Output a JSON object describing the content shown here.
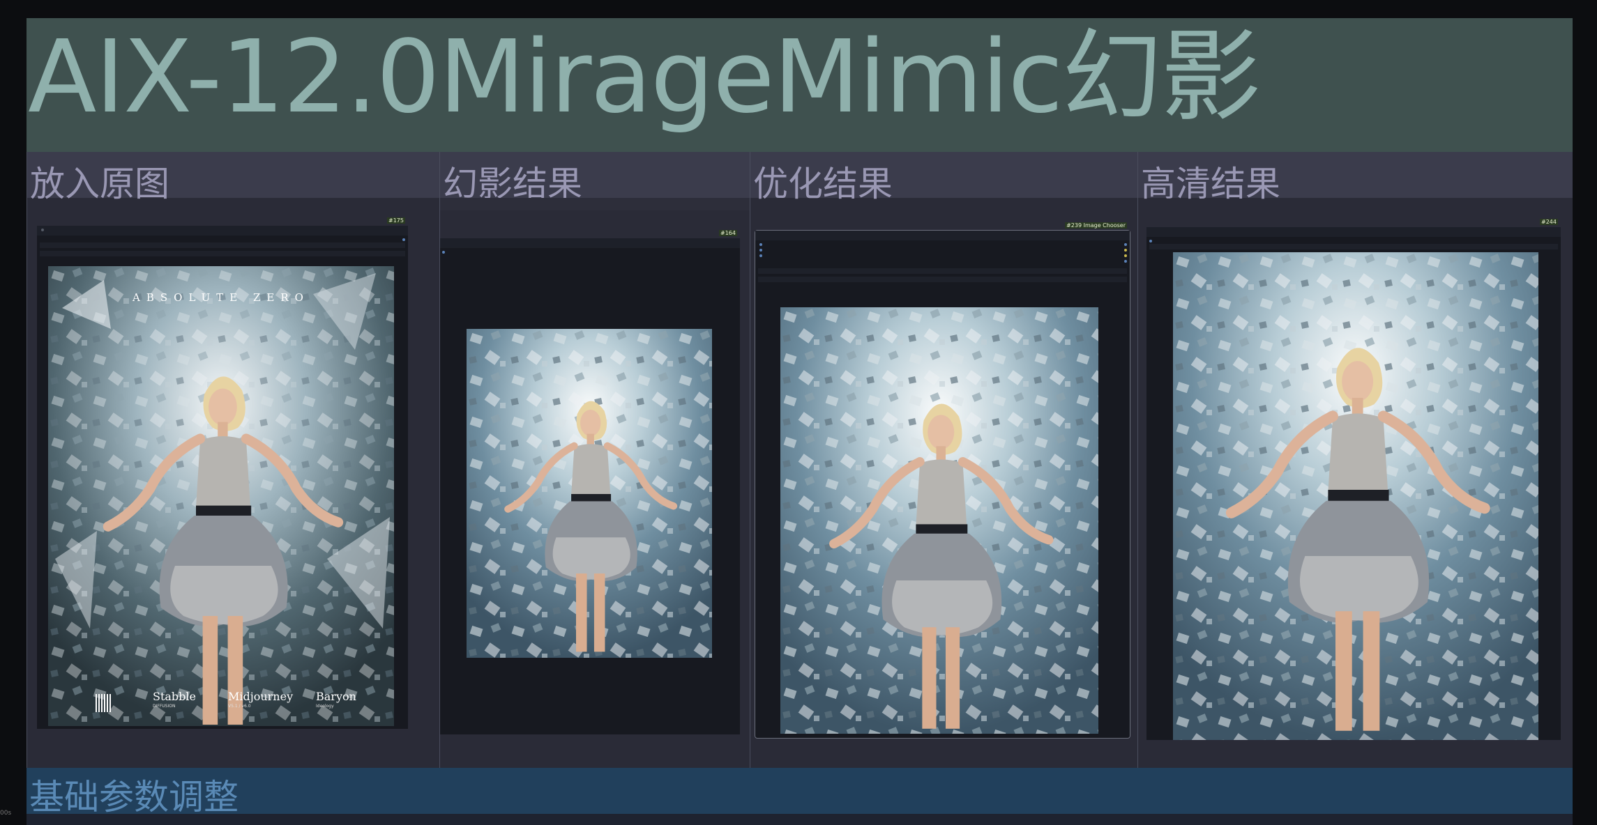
{
  "title": "AIX-12.0MirageMimic幻影",
  "columns": [
    {
      "title": "放入原图",
      "node_badge": "#175"
    },
    {
      "title": "幻影结果",
      "node_badge": "#164"
    },
    {
      "title": "优化结果",
      "node_badge": "#239 Image Chooser"
    },
    {
      "title": "高清结果",
      "node_badge": "#244"
    }
  ],
  "poster": {
    "header": "ABSOLUTE ZERO",
    "logos": [
      "Stabble",
      "Midjourney",
      "Baryon"
    ],
    "logo_subs": [
      "DIFFUSION",
      "V5.1 / v6.0",
      "Ideology"
    ]
  },
  "params_title": "基础参数调整",
  "corner_label": "00s",
  "colors": {
    "title_bg": "#3f514f",
    "column_bg": "#2a2b37",
    "params_bg": "#21405c"
  }
}
